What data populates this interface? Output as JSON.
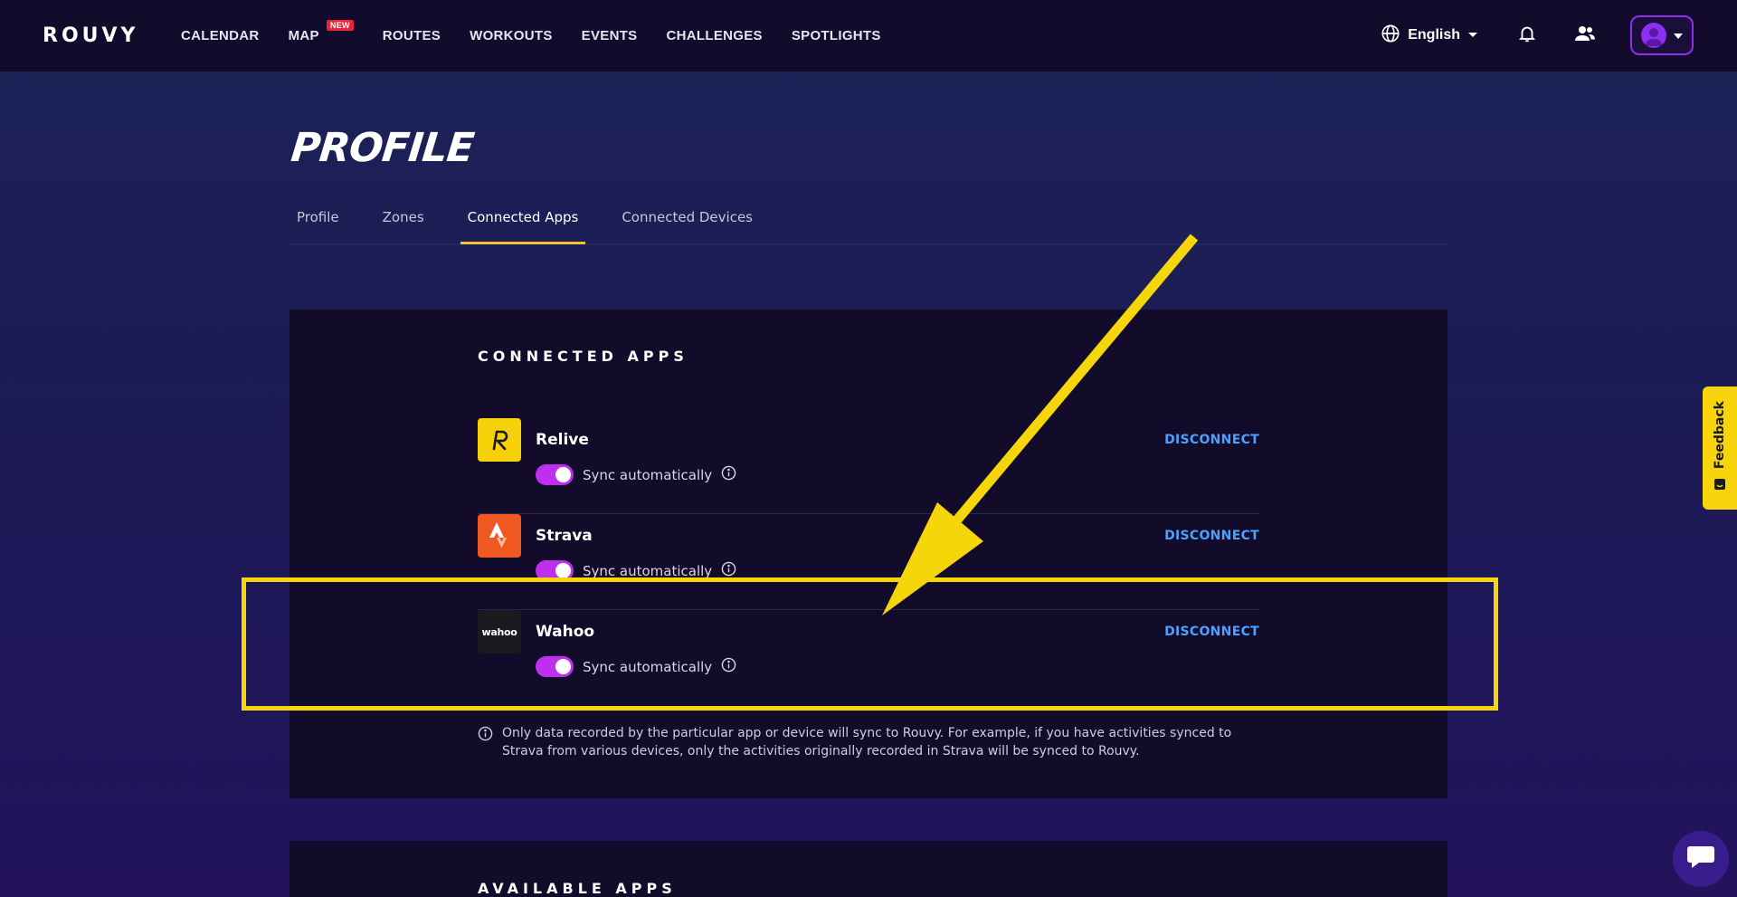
{
  "brand": {
    "logo_text": "ROUVY"
  },
  "nav": {
    "items": [
      {
        "label": "CALENDAR"
      },
      {
        "label": "MAP",
        "badge": "NEW"
      },
      {
        "label": "ROUTES"
      },
      {
        "label": "WORKOUTS"
      },
      {
        "label": "EVENTS"
      },
      {
        "label": "CHALLENGES"
      },
      {
        "label": "SPOTLIGHTS"
      }
    ],
    "language": "English"
  },
  "page": {
    "title": "PROFILE",
    "tabs": [
      {
        "label": "Profile"
      },
      {
        "label": "Zones"
      },
      {
        "label": "Connected Apps",
        "active": true
      },
      {
        "label": "Connected Devices"
      }
    ]
  },
  "connected_apps": {
    "heading": "CONNECTED APPS",
    "apps": [
      {
        "name": "Relive",
        "sync_label": "Sync automatically",
        "sync_on": true,
        "action": "DISCONNECT",
        "logo_color": "#f6d10a"
      },
      {
        "name": "Strava",
        "sync_label": "Sync automatically",
        "sync_on": true,
        "action": "DISCONNECT",
        "logo_color": "#f05a22"
      },
      {
        "name": "Wahoo",
        "sync_label": "Sync automatically",
        "sync_on": true,
        "action": "DISCONNECT",
        "logo_color": "#1b1b1f",
        "logo_text": "wahoo"
      }
    ],
    "note": "Only data recorded by the particular app or device will sync to Rouvy. For example, if you have activities synced to Strava from various devices, only the activities originally recorded in Strava will be synced to Rouvy."
  },
  "available_apps": {
    "heading": "AVAILABLE APPS"
  },
  "feedback": {
    "label": "Feedback"
  },
  "colors": {
    "accent_yellow": "#f5d60a",
    "toggle_on": "#c02ef0",
    "link_blue": "#4aa1ff",
    "topbar_bg": "#130b2b"
  }
}
